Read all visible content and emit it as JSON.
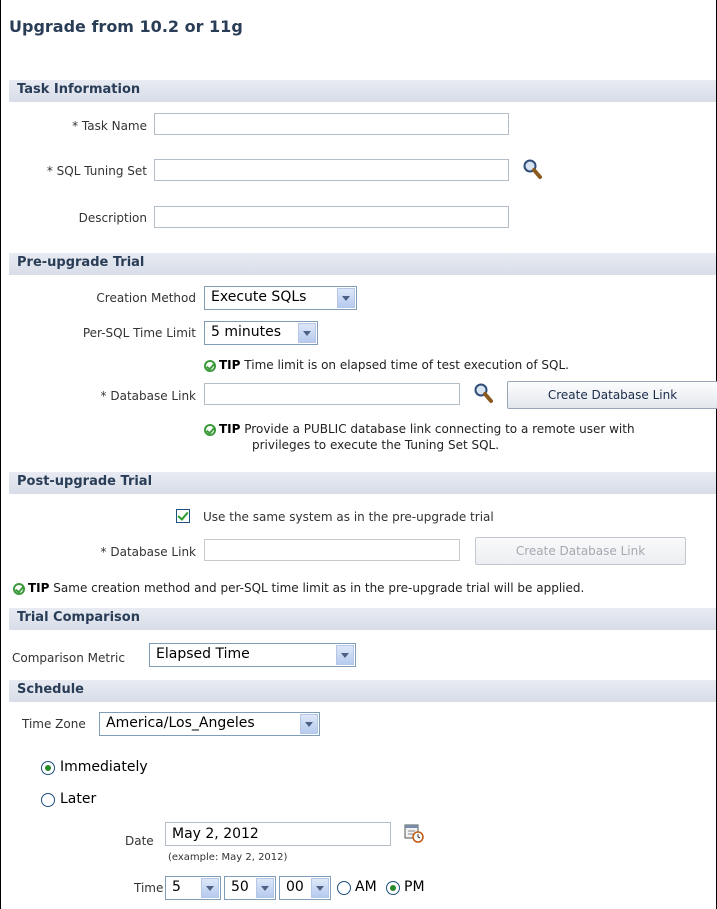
{
  "page": {
    "title": "Upgrade from 10.2 or 11g"
  },
  "task_info": {
    "header": "Task Information",
    "task_name_label": "* Task Name",
    "task_name_value": "",
    "sql_tuning_set_label": "* SQL Tuning Set",
    "sql_tuning_set_value": "",
    "description_label": "Description",
    "description_value": ""
  },
  "pre_upgrade": {
    "header": "Pre-upgrade Trial",
    "creation_method_label": "Creation Method",
    "creation_method_value": "Execute SQLs",
    "time_limit_label": "Per-SQL Time Limit",
    "time_limit_value": "5 minutes",
    "tip_label": "TIP",
    "tip1_text": "Time limit is on elapsed time of test execution of SQL.",
    "db_link_label": "* Database Link",
    "db_link_value": "",
    "create_link_button": "Create Database Link",
    "tip2_line1": "Provide a PUBLIC database link connecting to a remote user with",
    "tip2_line2": "privileges to execute the Tuning Set SQL."
  },
  "post_upgrade": {
    "header": "Post-upgrade Trial",
    "same_system_label": "Use the same system as in the pre-upgrade trial",
    "same_system_checked": true,
    "db_link_label": "* Database Link",
    "db_link_value": "",
    "create_link_button": "Create Database Link",
    "tip_label": "TIP",
    "tip_text": "Same creation method and per-SQL time limit as in the pre-upgrade trial will be applied."
  },
  "trial_comparison": {
    "header": "Trial Comparison",
    "metric_label": "Comparison Metric",
    "metric_value": "Elapsed Time"
  },
  "schedule": {
    "header": "Schedule",
    "time_zone_label": "Time Zone",
    "time_zone_value": "America/Los_Angeles",
    "immediately_label": "Immediately",
    "later_label": "Later",
    "selected": "Immediately",
    "date_label": "Date",
    "date_value": "May 2, 2012",
    "date_example": "(example: May 2, 2012)",
    "time_label": "Time",
    "hour": "5",
    "minute": "50",
    "second": "00",
    "am_label": "AM",
    "pm_label": "PM",
    "ampm_selected": "PM"
  }
}
